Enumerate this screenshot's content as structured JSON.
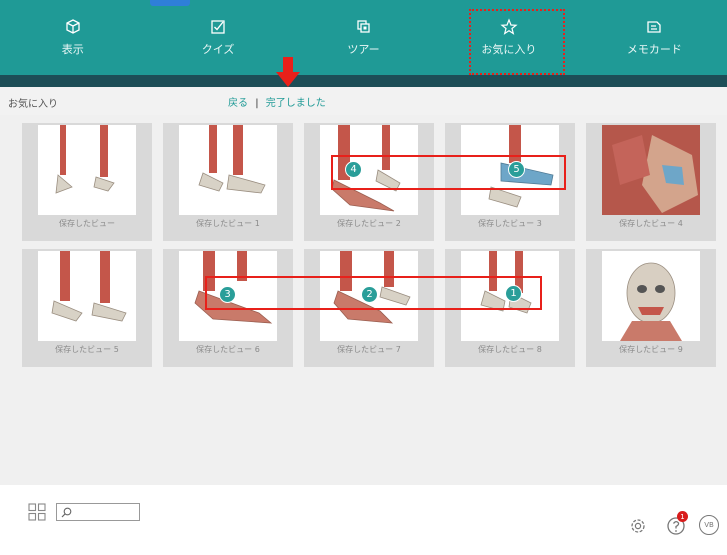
{
  "toolbar": {
    "items": [
      {
        "label": "表示",
        "icon": "cube-icon"
      },
      {
        "label": "クイズ",
        "icon": "checkbox-icon"
      },
      {
        "label": "ツアー",
        "icon": "layers-icon"
      },
      {
        "label": "お気に入り",
        "icon": "star-icon"
      },
      {
        "label": "メモカード",
        "icon": "note-card-icon"
      }
    ]
  },
  "subheader": {
    "title": "お気に入り",
    "back": "戻る",
    "separator": "|",
    "done": "完了しました"
  },
  "cards": [
    {
      "caption": "保存したビュー",
      "content": "feet-skeleton"
    },
    {
      "caption": "保存したビュー 1",
      "content": "feet-skeleton"
    },
    {
      "caption": "保存したビュー 2",
      "content": "feet-muscle",
      "badge": "4"
    },
    {
      "caption": "保存したビュー 3",
      "content": "feet-muscle",
      "badge": "5"
    },
    {
      "caption": "保存したビュー 4",
      "content": "shoulder"
    },
    {
      "caption": "保存したビュー 5",
      "content": "feet-skeleton"
    },
    {
      "caption": "保存したビュー 6",
      "content": "feet-muscle",
      "badge": "3"
    },
    {
      "caption": "保存したビュー 7",
      "content": "feet-muscle",
      "badge": "2"
    },
    {
      "caption": "保存したビュー 8",
      "content": "feet-skeleton",
      "badge": "1"
    },
    {
      "caption": "保存したビュー 9",
      "content": "head"
    }
  ],
  "bottom": {
    "search_placeholder": "",
    "vb_label": "VB",
    "help_badge": "1"
  },
  "colors": {
    "toolbar": "#1f9a96",
    "darkbar": "#1d4e57",
    "accent": "#1f9a96",
    "annotation": "#e8201a"
  }
}
